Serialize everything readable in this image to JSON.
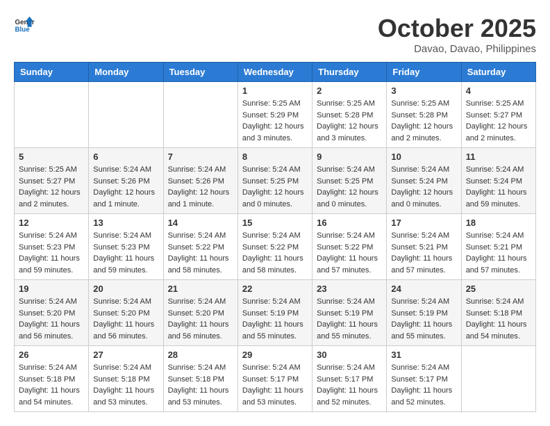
{
  "header": {
    "logo_general": "General",
    "logo_blue": "Blue",
    "month": "October 2025",
    "location": "Davao, Davao, Philippines"
  },
  "weekdays": [
    "Sunday",
    "Monday",
    "Tuesday",
    "Wednesday",
    "Thursday",
    "Friday",
    "Saturday"
  ],
  "weeks": [
    [
      {
        "day": "",
        "sunrise": "",
        "sunset": "",
        "daylight": "",
        "empty": true
      },
      {
        "day": "",
        "sunrise": "",
        "sunset": "",
        "daylight": "",
        "empty": true
      },
      {
        "day": "",
        "sunrise": "",
        "sunset": "",
        "daylight": "",
        "empty": true
      },
      {
        "day": "1",
        "sunrise": "Sunrise: 5:25 AM",
        "sunset": "Sunset: 5:29 PM",
        "daylight": "Daylight: 12 hours and 3 minutes."
      },
      {
        "day": "2",
        "sunrise": "Sunrise: 5:25 AM",
        "sunset": "Sunset: 5:28 PM",
        "daylight": "Daylight: 12 hours and 3 minutes."
      },
      {
        "day": "3",
        "sunrise": "Sunrise: 5:25 AM",
        "sunset": "Sunset: 5:28 PM",
        "daylight": "Daylight: 12 hours and 2 minutes."
      },
      {
        "day": "4",
        "sunrise": "Sunrise: 5:25 AM",
        "sunset": "Sunset: 5:27 PM",
        "daylight": "Daylight: 12 hours and 2 minutes."
      }
    ],
    [
      {
        "day": "5",
        "sunrise": "Sunrise: 5:25 AM",
        "sunset": "Sunset: 5:27 PM",
        "daylight": "Daylight: 12 hours and 2 minutes."
      },
      {
        "day": "6",
        "sunrise": "Sunrise: 5:24 AM",
        "sunset": "Sunset: 5:26 PM",
        "daylight": "Daylight: 12 hours and 1 minute."
      },
      {
        "day": "7",
        "sunrise": "Sunrise: 5:24 AM",
        "sunset": "Sunset: 5:26 PM",
        "daylight": "Daylight: 12 hours and 1 minute."
      },
      {
        "day": "8",
        "sunrise": "Sunrise: 5:24 AM",
        "sunset": "Sunset: 5:25 PM",
        "daylight": "Daylight: 12 hours and 0 minutes."
      },
      {
        "day": "9",
        "sunrise": "Sunrise: 5:24 AM",
        "sunset": "Sunset: 5:25 PM",
        "daylight": "Daylight: 12 hours and 0 minutes."
      },
      {
        "day": "10",
        "sunrise": "Sunrise: 5:24 AM",
        "sunset": "Sunset: 5:24 PM",
        "daylight": "Daylight: 12 hours and 0 minutes."
      },
      {
        "day": "11",
        "sunrise": "Sunrise: 5:24 AM",
        "sunset": "Sunset: 5:24 PM",
        "daylight": "Daylight: 11 hours and 59 minutes."
      }
    ],
    [
      {
        "day": "12",
        "sunrise": "Sunrise: 5:24 AM",
        "sunset": "Sunset: 5:23 PM",
        "daylight": "Daylight: 11 hours and 59 minutes."
      },
      {
        "day": "13",
        "sunrise": "Sunrise: 5:24 AM",
        "sunset": "Sunset: 5:23 PM",
        "daylight": "Daylight: 11 hours and 59 minutes."
      },
      {
        "day": "14",
        "sunrise": "Sunrise: 5:24 AM",
        "sunset": "Sunset: 5:22 PM",
        "daylight": "Daylight: 11 hours and 58 minutes."
      },
      {
        "day": "15",
        "sunrise": "Sunrise: 5:24 AM",
        "sunset": "Sunset: 5:22 PM",
        "daylight": "Daylight: 11 hours and 58 minutes."
      },
      {
        "day": "16",
        "sunrise": "Sunrise: 5:24 AM",
        "sunset": "Sunset: 5:22 PM",
        "daylight": "Daylight: 11 hours and 57 minutes."
      },
      {
        "day": "17",
        "sunrise": "Sunrise: 5:24 AM",
        "sunset": "Sunset: 5:21 PM",
        "daylight": "Daylight: 11 hours and 57 minutes."
      },
      {
        "day": "18",
        "sunrise": "Sunrise: 5:24 AM",
        "sunset": "Sunset: 5:21 PM",
        "daylight": "Daylight: 11 hours and 57 minutes."
      }
    ],
    [
      {
        "day": "19",
        "sunrise": "Sunrise: 5:24 AM",
        "sunset": "Sunset: 5:20 PM",
        "daylight": "Daylight: 11 hours and 56 minutes."
      },
      {
        "day": "20",
        "sunrise": "Sunrise: 5:24 AM",
        "sunset": "Sunset: 5:20 PM",
        "daylight": "Daylight: 11 hours and 56 minutes."
      },
      {
        "day": "21",
        "sunrise": "Sunrise: 5:24 AM",
        "sunset": "Sunset: 5:20 PM",
        "daylight": "Daylight: 11 hours and 56 minutes."
      },
      {
        "day": "22",
        "sunrise": "Sunrise: 5:24 AM",
        "sunset": "Sunset: 5:19 PM",
        "daylight": "Daylight: 11 hours and 55 minutes."
      },
      {
        "day": "23",
        "sunrise": "Sunrise: 5:24 AM",
        "sunset": "Sunset: 5:19 PM",
        "daylight": "Daylight: 11 hours and 55 minutes."
      },
      {
        "day": "24",
        "sunrise": "Sunrise: 5:24 AM",
        "sunset": "Sunset: 5:19 PM",
        "daylight": "Daylight: 11 hours and 55 minutes."
      },
      {
        "day": "25",
        "sunrise": "Sunrise: 5:24 AM",
        "sunset": "Sunset: 5:18 PM",
        "daylight": "Daylight: 11 hours and 54 minutes."
      }
    ],
    [
      {
        "day": "26",
        "sunrise": "Sunrise: 5:24 AM",
        "sunset": "Sunset: 5:18 PM",
        "daylight": "Daylight: 11 hours and 54 minutes."
      },
      {
        "day": "27",
        "sunrise": "Sunrise: 5:24 AM",
        "sunset": "Sunset: 5:18 PM",
        "daylight": "Daylight: 11 hours and 53 minutes."
      },
      {
        "day": "28",
        "sunrise": "Sunrise: 5:24 AM",
        "sunset": "Sunset: 5:18 PM",
        "daylight": "Daylight: 11 hours and 53 minutes."
      },
      {
        "day": "29",
        "sunrise": "Sunrise: 5:24 AM",
        "sunset": "Sunset: 5:17 PM",
        "daylight": "Daylight: 11 hours and 53 minutes."
      },
      {
        "day": "30",
        "sunrise": "Sunrise: 5:24 AM",
        "sunset": "Sunset: 5:17 PM",
        "daylight": "Daylight: 11 hours and 52 minutes."
      },
      {
        "day": "31",
        "sunrise": "Sunrise: 5:24 AM",
        "sunset": "Sunset: 5:17 PM",
        "daylight": "Daylight: 11 hours and 52 minutes."
      },
      {
        "day": "",
        "sunrise": "",
        "sunset": "",
        "daylight": "",
        "empty": true
      }
    ]
  ]
}
